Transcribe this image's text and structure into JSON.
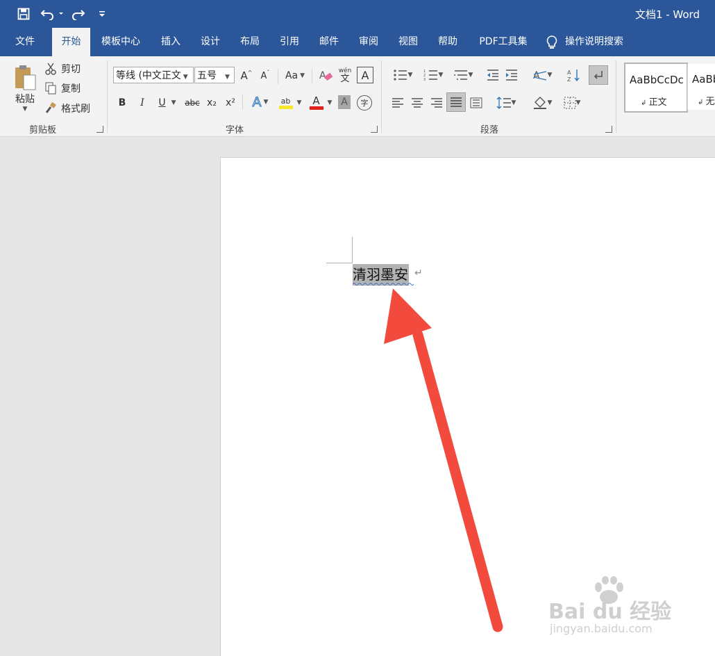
{
  "quick_access": {
    "save_icon": "save-icon",
    "undo_icon": "undo-icon",
    "redo_icon": "redo-icon",
    "customize_icon": "customize-icon"
  },
  "window": {
    "title": "文档1  -  Word"
  },
  "tabs": [
    "文件",
    "开始",
    "模板中心",
    "插入",
    "设计",
    "布局",
    "引用",
    "邮件",
    "审阅",
    "视图",
    "帮助",
    "PDF工具集"
  ],
  "tell_me": {
    "icon": "lightbulb-icon",
    "label": "操作说明搜索"
  },
  "clipboard": {
    "paste": "粘贴",
    "cut": "剪切",
    "copy": "复制",
    "format_painter": "格式刷",
    "group_label": "剪贴板"
  },
  "font": {
    "font_name": "等线 (中文正文",
    "font_size": "五号",
    "grow": "A",
    "shrink": "A",
    "change_case": "Aa",
    "phonetic": "wén",
    "bold": "B",
    "italic": "I",
    "underline": "U",
    "strikethrough": "abc",
    "subscript": "x₂",
    "superscript": "x²",
    "text_effects": "A",
    "highlight": "ab",
    "font_color": "A",
    "char_shading": "A",
    "enclose": "字",
    "group_label": "字体"
  },
  "paragraph": {
    "group_label": "段落"
  },
  "styles": {
    "normal_preview": "AaBbCcDc",
    "normal_label": "正文",
    "no_spacing_preview": "AaBb",
    "no_spacing_label": "无"
  },
  "document": {
    "text": "清羽墨安",
    "para_mark": "↵"
  },
  "watermark": {
    "brand": "Bai du 经验",
    "url": "jingyan.baidu.com"
  },
  "colors": {
    "ribbon_blue": "#2b579a",
    "arrow_red": "#f24a3d",
    "highlight_yellow": "#f7e92a",
    "font_red": "#e0201b"
  }
}
